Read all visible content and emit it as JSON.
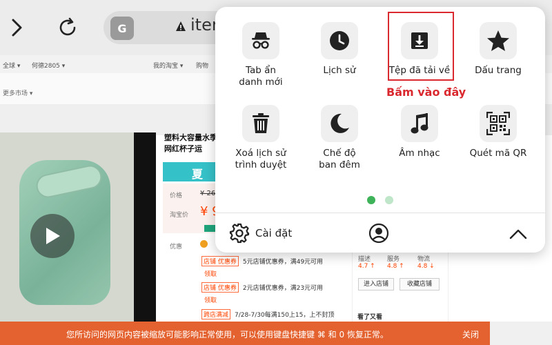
{
  "browser": {
    "url_text": "iter",
    "translate_glyph": "G"
  },
  "page": {
    "topbar": {
      "region": "全球 ▾",
      "user": "何德2805 ▾",
      "my_taobao": "我的淘宝 ▾",
      "cart": "购物"
    },
    "more_market": "更多市场 ▾",
    "product_title": "塑料大容量水季网红杯子运",
    "banner_text": "夏",
    "price_label": "价格",
    "price_value": "¥ 26",
    "taobao_price_label": "淘宝价",
    "taobao_price_value": "¥ 9",
    "youhui_label": "优惠",
    "coupons": [
      {
        "tag": "店铺 优惠券",
        "text": "5元店铺优惠券，满49元可用",
        "link": "领取"
      },
      {
        "tag": "店铺 优惠券",
        "text": "2元店铺优惠券，满23元可用",
        "link": "领取"
      },
      {
        "tag": "跨店满减",
        "text": "7/28-7/30每满150上15，上不封顶",
        "link": ""
      }
    ],
    "shop_scores": [
      {
        "label": "描述",
        "value": "4.7 ↑"
      },
      {
        "label": "服务",
        "value": "4.8 ↑"
      },
      {
        "label": "物流",
        "value": "4.8 ↓"
      }
    ],
    "shop_buttons": [
      "进入店铺",
      "收藏店铺"
    ],
    "seen_label": "看了又看",
    "notice": {
      "text": "您所访问的网页内容被缩放可能影响正常使用，可以使用键盘快捷键 ⌘ 和 0 恢复正常。",
      "close": "关闭"
    }
  },
  "menu": {
    "items": [
      {
        "label": "Tab ẩn\ndanh mới",
        "icon": "incognito-icon"
      },
      {
        "label": "Lịch sử",
        "icon": "clock-icon"
      },
      {
        "label": "Tệp đã tải về",
        "icon": "download-icon"
      },
      {
        "label": "Dấu trang",
        "icon": "star-icon"
      },
      {
        "label": "Xoá lịch sử\ntrình duyệt",
        "icon": "trash-icon"
      },
      {
        "label": "Chế độ\nban đêm",
        "icon": "moon-icon"
      },
      {
        "label": "Âm nhạc",
        "icon": "music-note-icon"
      },
      {
        "label": "Quét mã QR",
        "icon": "qr-code-icon"
      }
    ],
    "hint": "Bấm vào đây",
    "settings_label": "Cài đặt",
    "page_count": 2,
    "active_page": 1
  },
  "colors": {
    "highlight": "#d9292f",
    "active_dot": "#3fb35a",
    "notice_bar": "#e4622f",
    "price": "#ff4400"
  }
}
